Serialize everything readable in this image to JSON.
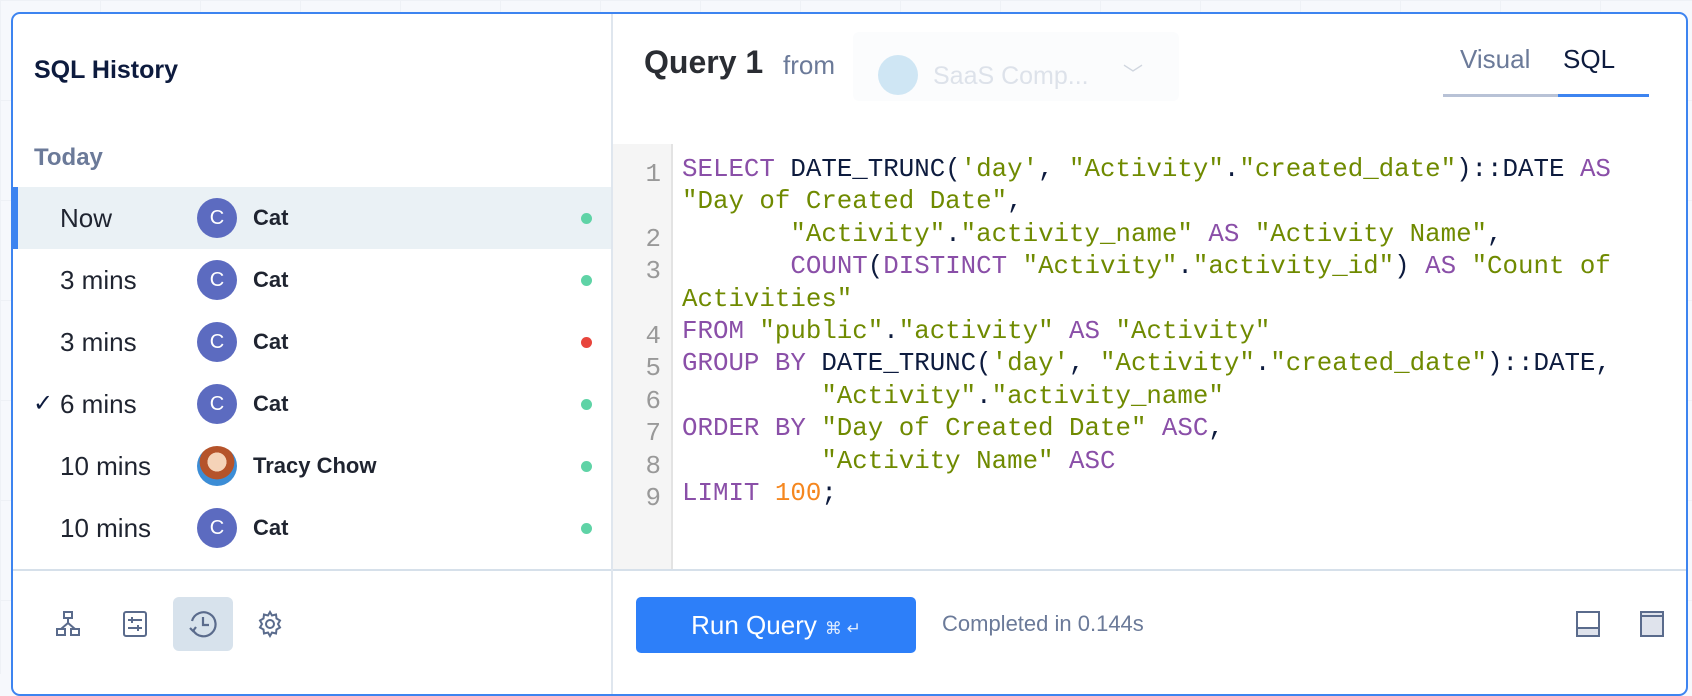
{
  "sidebar": {
    "title": "SQL History",
    "group": "Today",
    "items": [
      {
        "time": "Now",
        "user": "Cat",
        "initial": "C",
        "status": "success",
        "selected": true,
        "checked": false,
        "avatar": "initial"
      },
      {
        "time": "3 mins",
        "user": "Cat",
        "initial": "C",
        "status": "success",
        "selected": false,
        "checked": false,
        "avatar": "initial"
      },
      {
        "time": "3 mins",
        "user": "Cat",
        "initial": "C",
        "status": "error",
        "selected": false,
        "checked": false,
        "avatar": "initial"
      },
      {
        "time": "6 mins",
        "user": "Cat",
        "initial": "C",
        "status": "success",
        "selected": false,
        "checked": true,
        "avatar": "initial"
      },
      {
        "time": "10 mins",
        "user": "Tracy Chow",
        "initial": "",
        "status": "success",
        "selected": false,
        "checked": false,
        "avatar": "photo"
      },
      {
        "time": "10 mins",
        "user": "Cat",
        "initial": "C",
        "status": "success",
        "selected": false,
        "checked": false,
        "avatar": "initial"
      }
    ],
    "check_glyph": "✓",
    "tools": [
      "schema-icon",
      "filters-icon",
      "history-icon",
      "settings-icon"
    ],
    "active_tool": "history-icon"
  },
  "header": {
    "title": "Query 1",
    "from": "from",
    "datasource": "SaaS Comp...",
    "datasource_icon": "postgres-elephant-icon",
    "tabs": [
      {
        "label": "Visual",
        "active": false
      },
      {
        "label": "SQL",
        "active": true
      }
    ]
  },
  "editor": {
    "rows": [
      {
        "ln": "1",
        "tokens": [
          [
            "kw",
            "SELECT "
          ],
          [
            "plain",
            "DATE_TRUNC("
          ],
          [
            "str",
            "'day'"
          ],
          [
            "plain",
            ", "
          ],
          [
            "str",
            "\"Activity\""
          ],
          [
            "plain",
            "."
          ],
          [
            "str",
            "\"created_date\""
          ],
          [
            "plain",
            "):"
          ],
          [
            "plain",
            ":DATE "
          ],
          [
            "kw",
            "AS"
          ]
        ]
      },
      {
        "ln": "",
        "tokens": [
          [
            "str",
            "\"Day of Created Date\""
          ],
          [
            "plain",
            ","
          ]
        ]
      },
      {
        "ln": "2",
        "tokens": [
          [
            "plain",
            "       "
          ],
          [
            "str",
            "\"Activity\""
          ],
          [
            "plain",
            "."
          ],
          [
            "str",
            "\"activity_name\" "
          ],
          [
            "kw",
            "AS "
          ],
          [
            "str",
            "\"Activity Name\""
          ],
          [
            "plain",
            ","
          ]
        ]
      },
      {
        "ln": "3",
        "tokens": [
          [
            "plain",
            "       "
          ],
          [
            "kw",
            "COUNT"
          ],
          [
            "plain",
            "("
          ],
          [
            "kw",
            "DISTINCT "
          ],
          [
            "str",
            "\"Activity\""
          ],
          [
            "plain",
            "."
          ],
          [
            "str",
            "\"activity_id\""
          ],
          [
            "plain",
            ") "
          ],
          [
            "kw",
            "AS "
          ],
          [
            "str",
            "\"Count of"
          ]
        ]
      },
      {
        "ln": "",
        "tokens": [
          [
            "str",
            "Activities\""
          ]
        ]
      },
      {
        "ln": "4",
        "tokens": [
          [
            "kw",
            "FROM "
          ],
          [
            "str",
            "\"public\""
          ],
          [
            "plain",
            "."
          ],
          [
            "str",
            "\"activity\" "
          ],
          [
            "kw",
            "AS "
          ],
          [
            "str",
            "\"Activity\""
          ]
        ]
      },
      {
        "ln": "5",
        "tokens": [
          [
            "kw",
            "GROUP BY "
          ],
          [
            "plain",
            "DATE_TRUNC("
          ],
          [
            "str",
            "'day'"
          ],
          [
            "plain",
            ", "
          ],
          [
            "str",
            "\"Activity\""
          ],
          [
            "plain",
            "."
          ],
          [
            "str",
            "\"created_date\""
          ],
          [
            "plain",
            "):"
          ],
          [
            "plain",
            ":DATE,"
          ]
        ]
      },
      {
        "ln": "6",
        "tokens": [
          [
            "plain",
            "         "
          ],
          [
            "str",
            "\"Activity\""
          ],
          [
            "plain",
            "."
          ],
          [
            "str",
            "\"activity_name\""
          ]
        ]
      },
      {
        "ln": "7",
        "tokens": [
          [
            "kw",
            "ORDER BY "
          ],
          [
            "str",
            "\"Day of Created Date\" "
          ],
          [
            "kw",
            "ASC"
          ],
          [
            "plain",
            ","
          ]
        ]
      },
      {
        "ln": "8",
        "tokens": [
          [
            "plain",
            "         "
          ],
          [
            "str",
            "\"Activity Name\" "
          ],
          [
            "kw",
            "ASC"
          ]
        ]
      },
      {
        "ln": "9",
        "tokens": [
          [
            "kw",
            "LIMIT "
          ],
          [
            "num",
            "100"
          ],
          [
            "plain",
            ";"
          ]
        ]
      }
    ]
  },
  "footer": {
    "run_label": "Run Query",
    "run_shortcut": "⌘ ↵",
    "status": "Completed in 0.144s",
    "layout_icons": [
      "split-bottom-icon",
      "split-top-icon"
    ]
  },
  "colors": {
    "accent": "#2d7ff9",
    "success": "#5fd3a6",
    "error": "#e8453c",
    "keyword": "#8a4fa8",
    "string": "#6f8a00",
    "number": "#f5871f"
  }
}
